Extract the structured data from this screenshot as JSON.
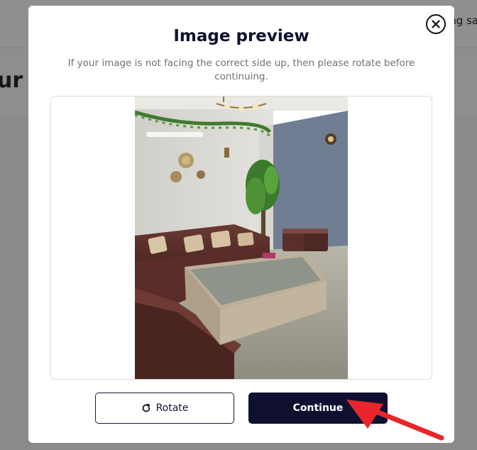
{
  "background": {
    "header_text": "ng sa",
    "heading_fragment": "ur"
  },
  "modal": {
    "title": "Image preview",
    "description": "If your image is not facing the correct side up, then please rotate before continuing.",
    "close_icon": "close-circle-icon",
    "rotate_label": "Rotate",
    "rotate_icon": "rotate-cw-icon",
    "continue_label": "Continue"
  },
  "colors": {
    "primary": "#0f1030",
    "annotation_arrow": "#e8262c"
  }
}
